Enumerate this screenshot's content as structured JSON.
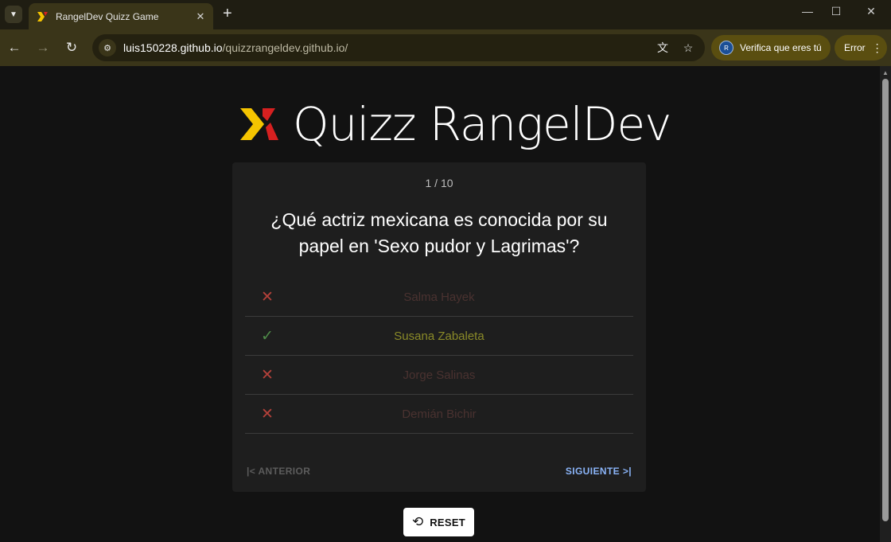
{
  "browser": {
    "tab_title": "RangelDev Quizz Game",
    "url_host": "luis150228.github.io",
    "url_path": "/quizzrangeldev.github.io/",
    "profile_label": "Verifica que eres tú",
    "profile_initial": "R",
    "error_label": "Error"
  },
  "app": {
    "title": "Quizz RangelDev"
  },
  "quiz": {
    "counter": "1 / 10",
    "question": "¿Qué actriz mexicana es conocida por su papel en 'Sexo pudor y Lagrimas'?",
    "answers": [
      {
        "label": "Salma Hayek",
        "status": "wrong"
      },
      {
        "label": "Susana Zabaleta",
        "status": "correct"
      },
      {
        "label": "Jorge Salinas",
        "status": "wrong"
      },
      {
        "label": "Demián Bichir",
        "status": "wrong"
      }
    ],
    "prev_label": "ANTERIOR",
    "next_label": "SIGUIENTE",
    "reset_label": "RESET"
  },
  "colors": {
    "correct": "#4e8a48",
    "wrong": "#b4413a",
    "logo_yellow": "#f5c400",
    "logo_red": "#d62020",
    "next_accent": "#8ab4f8"
  }
}
